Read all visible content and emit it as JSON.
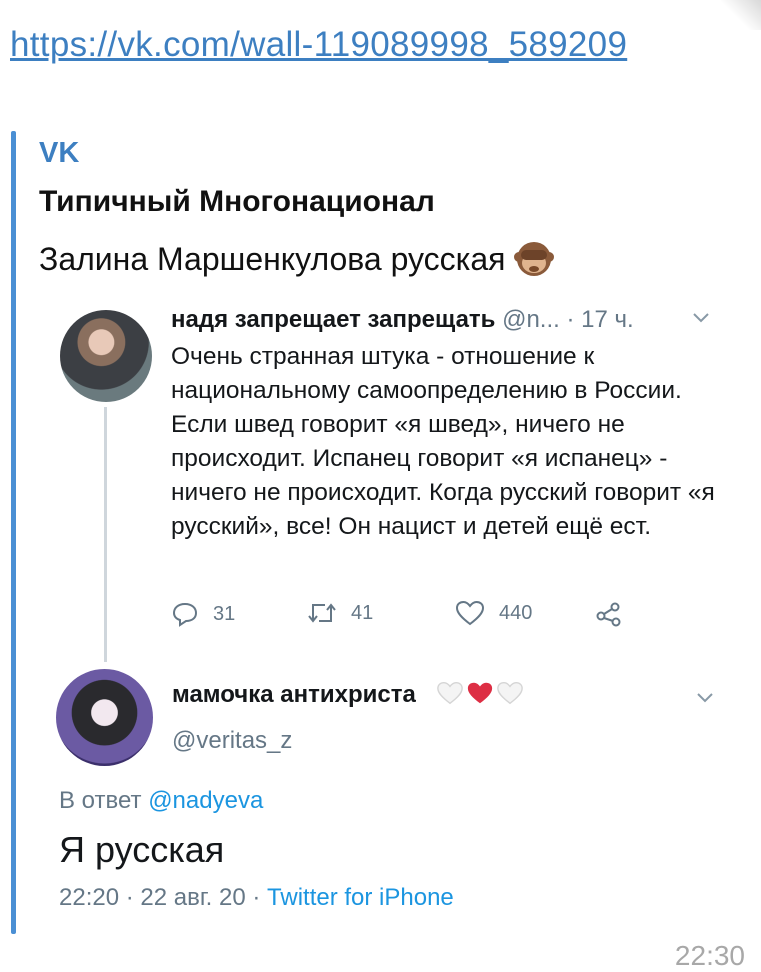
{
  "message": {
    "link": "https://vk.com/wall-119089998_589209",
    "time": "22:30"
  },
  "preview": {
    "site": "VK",
    "group": "Типичный Многонационал",
    "caption": "Залина Маршенкулова русская"
  },
  "tweet1": {
    "name": "надя запрещает запрещать",
    "handle": "@n...",
    "age": "· 17 ч.",
    "text": "Очень странная штука - отношение к национальному самоопределению в России. Если швед говорит «я швед», ничего не происходит. Испанец говорит «я испанец» - ничего не происходит. Когда русский говорит «я русский», все! Он нацист и детей ещё ест.",
    "replies": "31",
    "retweets": "41",
    "likes": "440"
  },
  "tweet2": {
    "name": "мамочка антихриста",
    "handle": "@veritas_z",
    "reply_label": "В ответ",
    "reply_mention": "@nadyeva",
    "text": "Я русская",
    "timestamp": "22:20 · 22 авг. 20 · ",
    "source": "Twitter for iPhone"
  },
  "icons": {
    "monkey": "see-no-evil-monkey-emoji",
    "hearts": [
      "white-heart",
      "red-heart",
      "white-heart"
    ]
  },
  "colors": {
    "link": "#3d7fc1",
    "quote_bar": "#4a8fd4",
    "twitter_blue": "#1b95e0",
    "muted": "#657786"
  }
}
